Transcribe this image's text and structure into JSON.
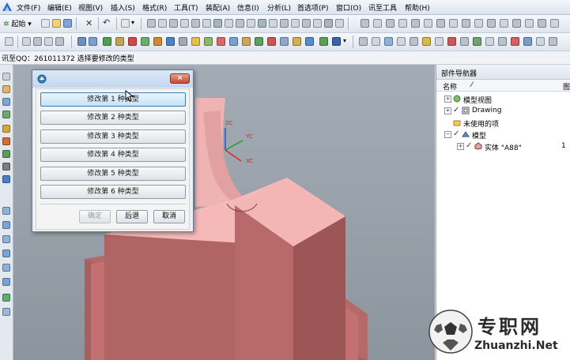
{
  "menu": {
    "items": [
      "文件(F)",
      "编辑(E)",
      "视图(V)",
      "插入(S)",
      "格式(R)",
      "工具(T)",
      "装配(A)",
      "信息(I)",
      "分析(L)",
      "首选项(P)",
      "窗口(O)",
      "讯至工具",
      "帮助(H)"
    ]
  },
  "toolbar": {
    "start_label": "起始"
  },
  "cue_line": {
    "text": "讯至QQ：261011372 选择要修改的类型"
  },
  "dialog": {
    "options": [
      "修改第 1 种类型",
      "修改第 2 种类型",
      "修改第 3 种类型",
      "修改第 4 种类型",
      "修改第 5 种类型",
      "修改第 6 种类型"
    ],
    "ok_label": "确定",
    "back_label": "后退",
    "cancel_label": "取消",
    "close_glyph": "×"
  },
  "viewport": {
    "axes": {
      "z": "ZC",
      "y": "YC",
      "x": "XC"
    },
    "model_color": "#c27070"
  },
  "navigator": {
    "title": "部件导航器",
    "columns": {
      "name": "名称",
      "sort_glyph": "⁄",
      "extra": "图"
    },
    "rows": [
      {
        "label": "模型视图",
        "expander": "+",
        "check": "",
        "value": ""
      },
      {
        "label": "Drawing",
        "expander": "+",
        "check": "✓",
        "value": ""
      },
      {
        "label": "未使用的项",
        "expander": "",
        "check": "",
        "value": ""
      },
      {
        "label": "模型",
        "expander": "−",
        "check": "✓",
        "value": ""
      },
      {
        "label": "实体 \"A88\"",
        "expander": "+",
        "check": "✓",
        "value": "1"
      }
    ]
  },
  "watermark": {
    "title": "专职网",
    "url": "Zhuanzhi.Net"
  }
}
